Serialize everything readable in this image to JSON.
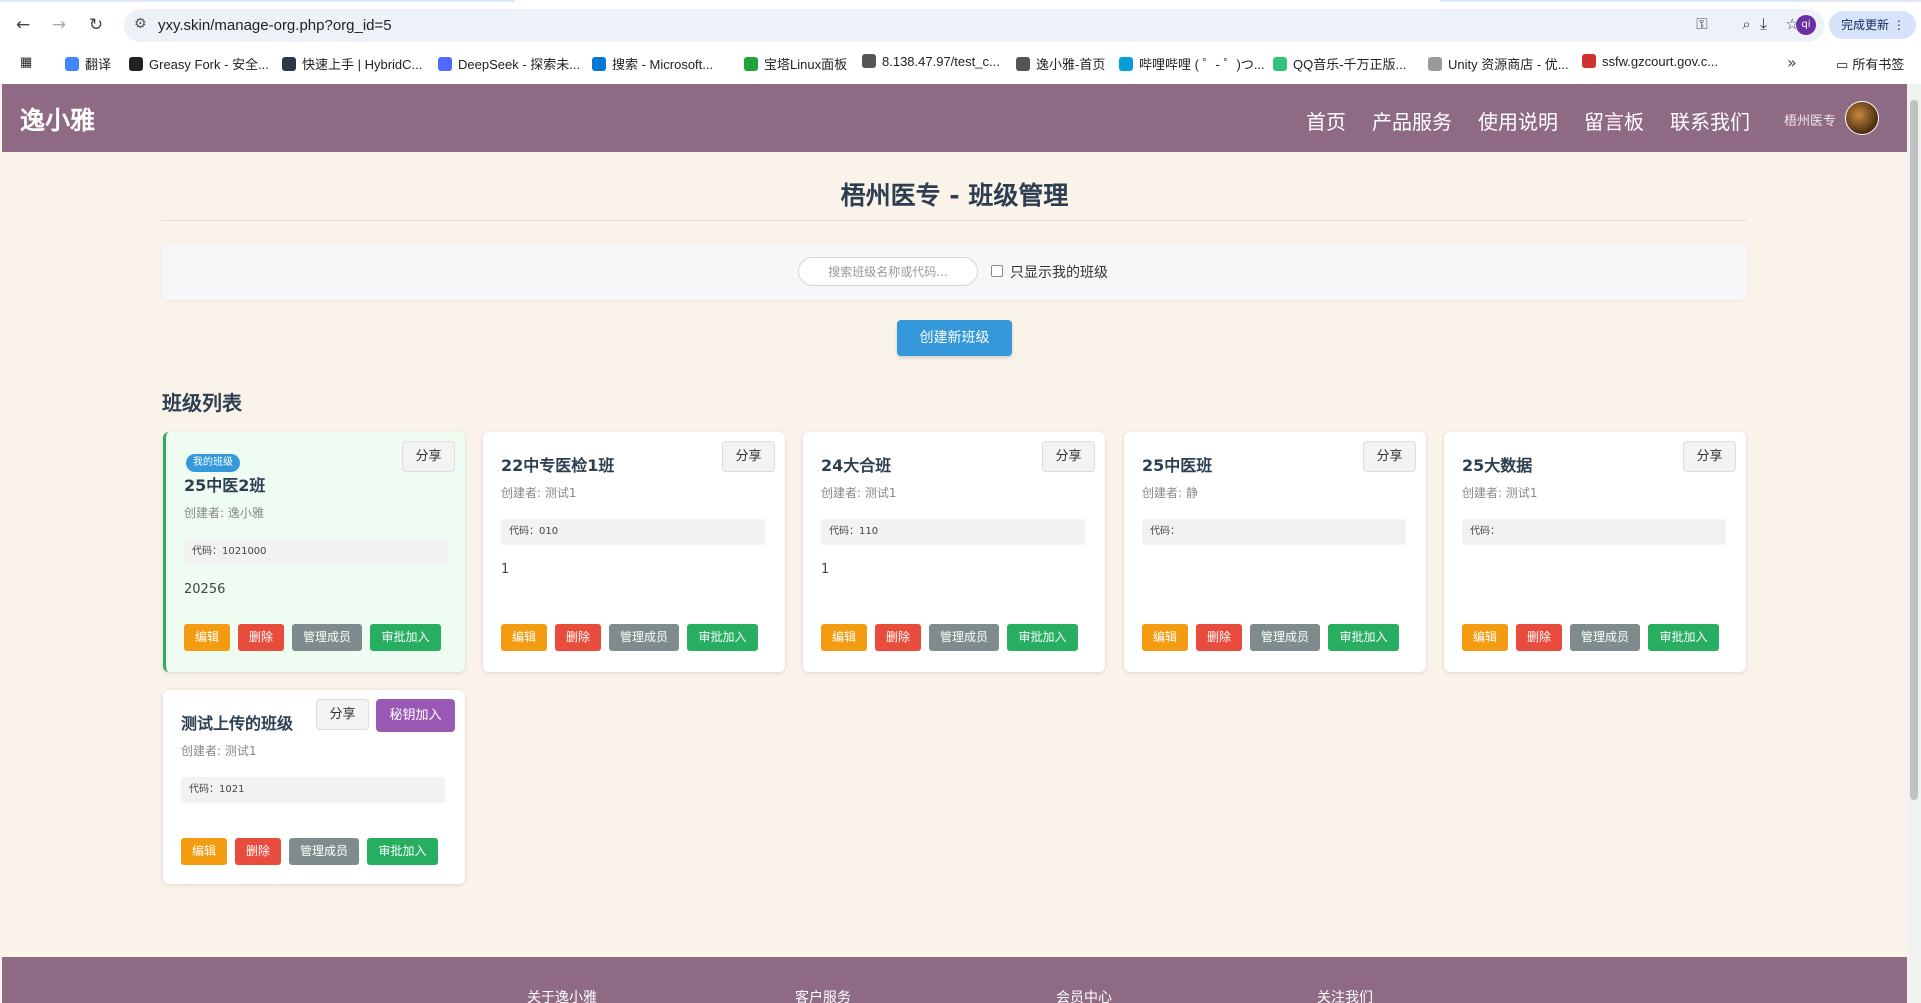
{
  "browser": {
    "url": "yxy.skin/manage-org.php?org_id=5",
    "profile_initial": "qi",
    "update_label": "完成更新",
    "bookmarks": [
      {
        "label": "翻译",
        "color": "#4285f4"
      },
      {
        "label": "Greasy Fork - 安全...",
        "color": "#222222"
      },
      {
        "label": "快速上手 | HybridC...",
        "color": "#2d3748"
      },
      {
        "label": "DeepSeek - 探索未...",
        "color": "#4d6bfe"
      },
      {
        "label": "搜索 - Microsoft...",
        "color": "#0078d4"
      },
      {
        "label": "宝塔Linux面板",
        "color": "#20a53a"
      },
      {
        "label": "8.138.47.97/test_c...",
        "color": "#555555"
      },
      {
        "label": "逸小雅-首页",
        "color": "#555555"
      },
      {
        "label": "哔哩哔哩 ( ゜- ゜)つ...",
        "color": "#00a1d6"
      },
      {
        "label": "QQ音乐-千万正版...",
        "color": "#31c27c"
      },
      {
        "label": "Unity 资源商店 - 优...",
        "color": "#999999"
      },
      {
        "label": "ssfw.gzcourt.gov.c...",
        "color": "#d03030"
      }
    ],
    "all_bookmarks_label": "所有书签"
  },
  "header": {
    "logo": "逸小雅",
    "nav": [
      "首页",
      "产品服务",
      "使用说明",
      "留言板",
      "联系我们"
    ],
    "user_name": "梧州医专"
  },
  "main": {
    "title": "梧州医专 - 班级管理",
    "search_placeholder": "搜索班级名称或代码...",
    "filter_label": "只显示我的班级",
    "create_label": "创建新班级",
    "section_title": "班级列表"
  },
  "card_labels": {
    "share": "分享",
    "key_join": "秘钥加入",
    "my_badge": "我的班级",
    "edit": "编辑",
    "delete": "删除",
    "members": "管理成员",
    "approve": "审批加入"
  },
  "classes": [
    {
      "name": "25中医2班",
      "creator": "创建者: 逸小雅",
      "code": "代码：1021000",
      "desc": "20256",
      "mine": true
    },
    {
      "name": "22中专医检1班",
      "creator": "创建者: 测试1",
      "code": "代码：010",
      "desc": "1",
      "mine": false
    },
    {
      "name": "24大合班",
      "creator": "创建者: 测试1",
      "code": "代码：110",
      "desc": "1",
      "mine": false
    },
    {
      "name": "25中医班",
      "creator": "创建者: 静",
      "code": "代码：",
      "desc": "",
      "mine": false
    },
    {
      "name": "25大数据",
      "creator": "创建者: 测试1",
      "code": "代码：",
      "desc": "",
      "mine": false
    },
    {
      "name": "测试上传的班级",
      "creator": "创建者: 测试1",
      "code": "代码：1021",
      "desc": "",
      "mine": false,
      "key_join": true
    }
  ],
  "footer": {
    "columns": [
      "关于逸小雅",
      "客户服务",
      "会员中心",
      "关注我们"
    ]
  },
  "colors": {
    "header": "#8f6a85",
    "primary": "#3498db",
    "edit": "#f39c12",
    "delete": "#e74c3c",
    "members": "#7f8c8d",
    "approve": "#27ae60",
    "key_join": "#9b59b6"
  }
}
